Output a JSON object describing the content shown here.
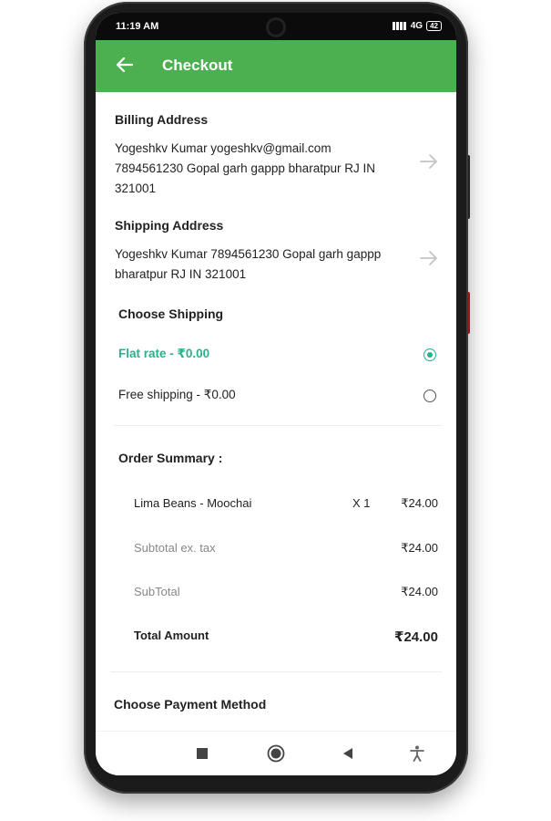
{
  "status_bar": {
    "time": "11:19 AM",
    "network": "4G",
    "battery": "42"
  },
  "app_bar": {
    "title": "Checkout",
    "accent_color": "#4caf50"
  },
  "billing": {
    "title": "Billing Address",
    "line1": "Yogeshkv Kumar yogeshkv@gmail.com",
    "line2": "7894561230 Gopal garh gappp bharatpur RJ IN",
    "line3": "321001"
  },
  "shipping_address": {
    "title": "Shipping Address",
    "line1": "Yogeshkv Kumar 7894561230 Gopal garh gappp",
    "line2": "bharatpur RJ IN 321001"
  },
  "shipping_methods": {
    "title": "Choose Shipping",
    "selected_color": "#26b38a",
    "options": [
      {
        "label": "Flat rate - ₹0.00",
        "selected": true
      },
      {
        "label": "Free shipping - ₹0.00",
        "selected": false
      }
    ]
  },
  "order_summary": {
    "title": "Order Summary :",
    "item": {
      "name": "Lima Beans - Moochai",
      "qty": "X 1",
      "price": "₹24.00"
    },
    "subtotal_ex_tax": {
      "label": "Subtotal ex. tax",
      "value": "₹24.00"
    },
    "subtotal": {
      "label": "SubTotal",
      "value": "₹24.00"
    },
    "total": {
      "label": "Total Amount",
      "value": "₹24.00"
    }
  },
  "payment": {
    "title": "Choose Payment Method"
  },
  "nav_bar": {
    "icons": [
      "recents-icon",
      "home-icon",
      "back-icon",
      "accessibility-icon"
    ]
  }
}
